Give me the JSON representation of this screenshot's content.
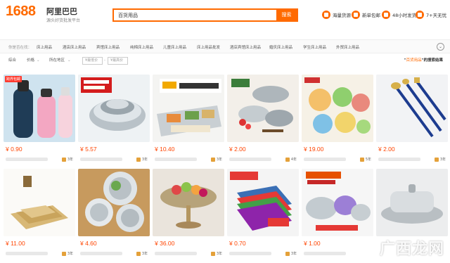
{
  "header": {
    "logo_number": "1688",
    "logo_name": "阿里巴巴",
    "logo_tagline": "源头好货批发平台",
    "search_value": "百货用品",
    "search_button": "搜索",
    "links": [
      {
        "label": "海量货源",
        "icon": "shop-icon"
      },
      {
        "label": "新单包邮",
        "icon": "truck-icon"
      },
      {
        "label": "48小时发货",
        "icon": "clock-icon"
      },
      {
        "label": "7+天无忧",
        "icon": "shield-icon"
      }
    ]
  },
  "categories": {
    "label": "你是否在找：",
    "items": [
      "床上用品",
      "酒店床上用品",
      "宾馆床上用品",
      "纯棉床上用品",
      "儿童床上用品",
      "床上用品批发",
      "酒店宾馆床上用品",
      "婚庆床上用品",
      "学生床上用品",
      "外贸床上用品"
    ]
  },
  "filters": {
    "items": [
      "综合",
      "价格",
      "所在地区"
    ],
    "price_min_placeholder": "¥最低价",
    "price_max_placeholder": "¥最高价",
    "result_text_prefix": "\"",
    "result_keyword": "百货用品",
    "result_text_suffix": "\"的搜索结果"
  },
  "products": [
    {
      "price": "¥ 0.90",
      "years": "3年",
      "badge": "跨界包邮",
      "type": "bottle"
    },
    {
      "price": "¥ 5.57",
      "years": "3年",
      "badge": "",
      "type": "pots"
    },
    {
      "price": "¥ 10.40",
      "years": "3年",
      "badge": "",
      "type": "tray"
    },
    {
      "price": "¥ 2.00",
      "years": "4年",
      "badge": "",
      "type": "bowls"
    },
    {
      "price": "¥ 19.00",
      "years": "5年",
      "badge": "",
      "type": "kidsplates"
    },
    {
      "price": "¥ 2.00",
      "years": "3年",
      "badge": "",
      "type": "cutlery"
    },
    {
      "price": "¥ 11.00",
      "years": "3年",
      "badge": "",
      "type": "bamboo"
    },
    {
      "price": "¥ 4.60",
      "years": "3年",
      "badge": "",
      "type": "plates"
    },
    {
      "price": "¥ 36.00",
      "years": "3年",
      "badge": "",
      "type": "fruitbowl"
    },
    {
      "price": "¥ 0.70",
      "years": "3年",
      "badge": "",
      "type": "sponges"
    },
    {
      "price": "¥ 1.00",
      "years": "",
      "badge": "",
      "type": "mixbowls"
    },
    {
      "price": "",
      "years": "",
      "badge": "",
      "type": "butterdish"
    }
  ],
  "watermark": "广西龙网",
  "colors": {
    "accent": "#ff6a00",
    "price": "#ff4400"
  }
}
